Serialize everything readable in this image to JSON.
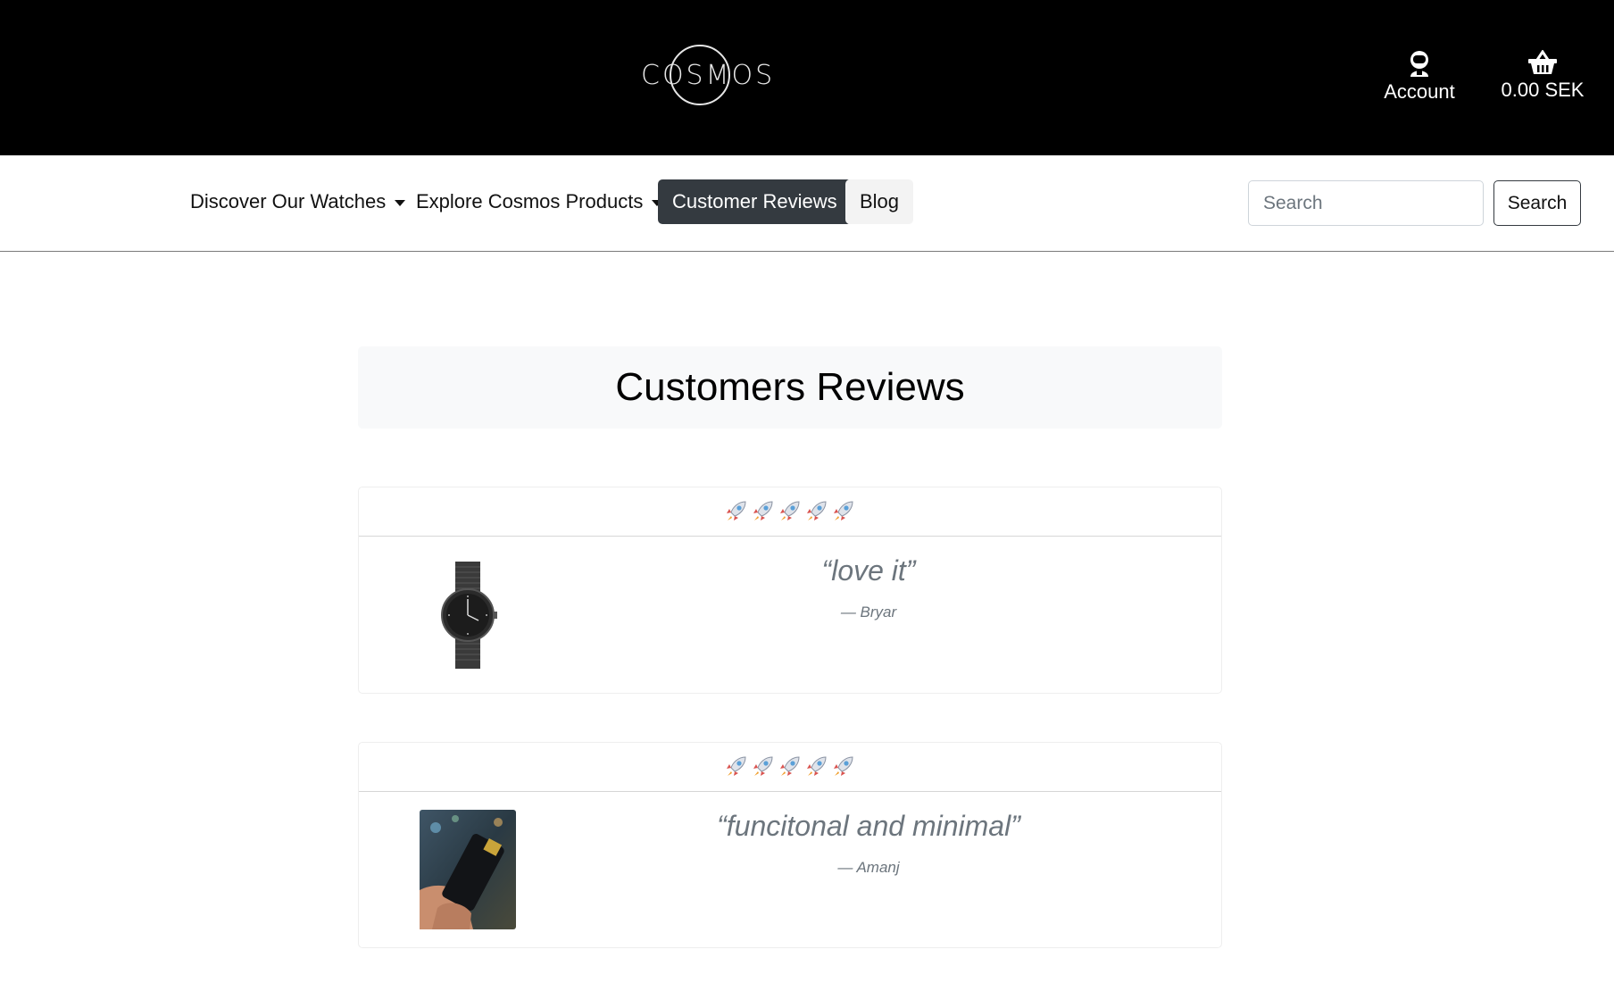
{
  "header": {
    "logo_text": "COSMOS",
    "account_label": "Account",
    "cart_label": "0.00 SEK"
  },
  "nav": {
    "items": [
      {
        "label": "Discover Our Watches",
        "dropdown": true
      },
      {
        "label": "Explore Cosmos Products",
        "dropdown": true
      },
      {
        "label": "Customer Reviews",
        "active": true
      },
      {
        "label": "Blog"
      }
    ],
    "search_placeholder": "Search",
    "search_button": "Search"
  },
  "main": {
    "title": "Customers Reviews",
    "reviews": [
      {
        "rating": 5,
        "rating_icon": "rocket-icon",
        "quote": "“love it”",
        "author": "— Bryar",
        "image": "black-watch-image"
      },
      {
        "rating": 5,
        "rating_icon": "rocket-icon",
        "quote": "“funcitonal and minimal”",
        "author": "— Amanj",
        "image": "card-holder-photo"
      }
    ]
  },
  "colors": {
    "header_bg": "#000000",
    "active_nav_bg": "#343a40",
    "title_bg": "#f8f9fa",
    "quote_color": "#6c757d"
  }
}
